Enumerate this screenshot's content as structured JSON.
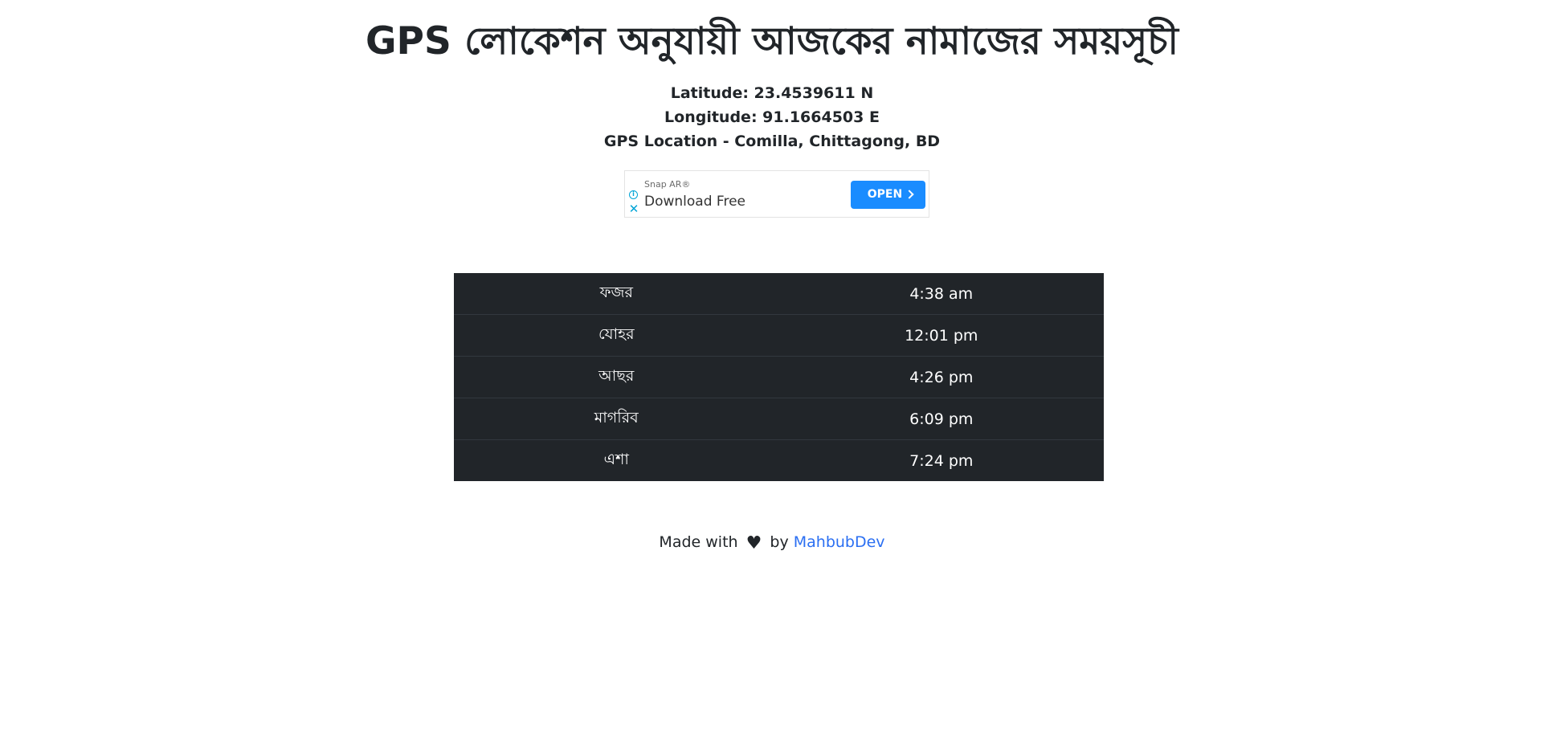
{
  "page": {
    "title": "GPS লোকেশন অনুযায়ী আজকের নামাজের সময়সূচী"
  },
  "location": {
    "latitude": "Latitude: 23.4539611 N",
    "longitude": "Longitude: 91.1664503 E",
    "gps_location": "GPS Location - Comilla, Chittagong, BD"
  },
  "ad": {
    "brand": "Snap AR®",
    "headline": "Download Free",
    "button_label": "OPEN",
    "info_icon": "info-icon",
    "close_icon": "close-icon",
    "button_color": "#1a8cff"
  },
  "prayer_times": [
    {
      "name": "ফজর",
      "time": "4:38 am"
    },
    {
      "name": "যোহর",
      "time": "12:01 pm"
    },
    {
      "name": "আছর",
      "time": "4:26 pm"
    },
    {
      "name": "মাগরিব",
      "time": "6:09 pm"
    },
    {
      "name": "এশা",
      "time": "7:24 pm"
    }
  ],
  "footer": {
    "made_with": "Made with",
    "heart_icon": "heart-icon",
    "by": "by",
    "author_link": "MahbubDev",
    "link_color": "#2b6ff2"
  },
  "colors": {
    "table_background": "#212529",
    "text": "#212529"
  }
}
